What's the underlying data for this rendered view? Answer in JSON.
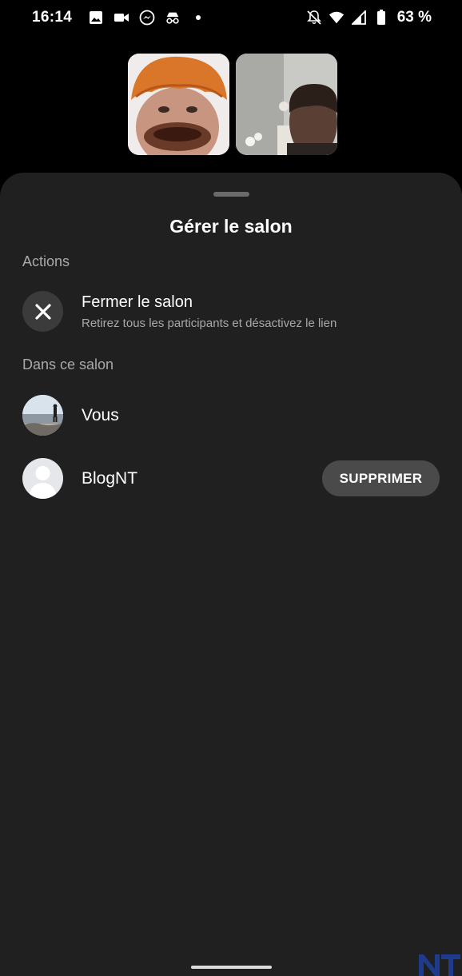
{
  "status_bar": {
    "time": "16:14",
    "battery": "63 %",
    "left_icons": [
      "image-icon",
      "video-camera-icon",
      "messenger-icon",
      "incognito-icon",
      "notification-dot-icon"
    ],
    "right_icons": [
      "notifications-off-icon",
      "wifi-icon",
      "signal-icon",
      "battery-icon"
    ]
  },
  "sheet": {
    "title": "Gérer le salon",
    "actions_label": "Actions",
    "close_room": {
      "title": "Fermer le salon",
      "subtitle": "Retirez tous les participants et désactivez le lien",
      "icon": "close-icon"
    },
    "members_label": "Dans ce salon",
    "members": [
      {
        "name": "Vous",
        "avatar": "landscape-avatar"
      },
      {
        "name": "BlogNT",
        "avatar": "default-avatar",
        "action_label": "SUPPRIMER"
      }
    ]
  },
  "colors": {
    "background": "#000000",
    "sheet": "#202020",
    "secondary_text": "#a9a9a9",
    "button": "#4a4a4a",
    "watermark": "#1f3b8c"
  }
}
